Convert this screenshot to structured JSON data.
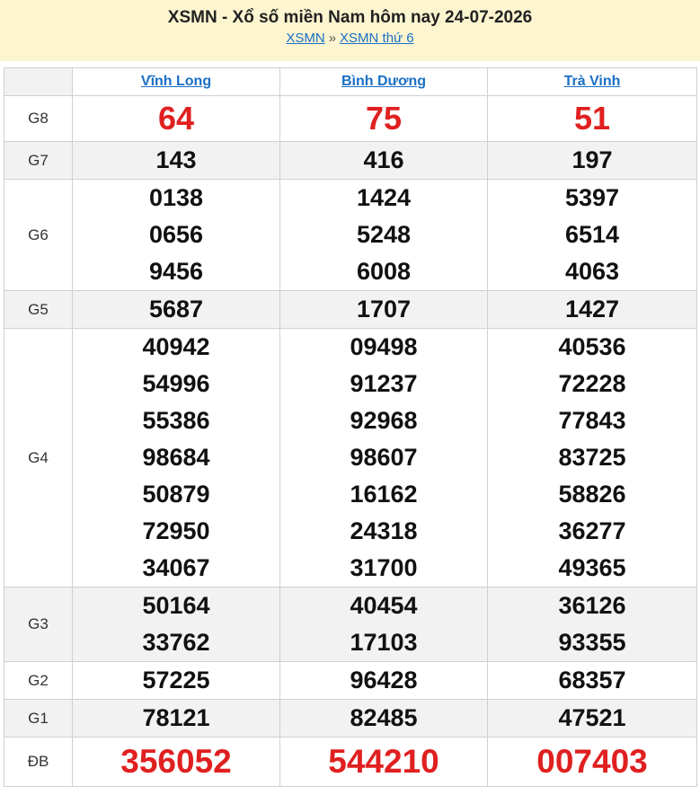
{
  "header": {
    "title": "XSMN - Xổ số miền Nam hôm nay 24-07-2026",
    "crumb1": "XSMN",
    "separator": "»",
    "crumb2": "XSMN thứ 6"
  },
  "provinces": [
    "Vĩnh Long",
    "Bình Dương",
    "Trà Vinh"
  ],
  "prizes": {
    "g8": {
      "label": "G8",
      "values": [
        "64",
        "75",
        "51"
      ]
    },
    "g7": {
      "label": "G7",
      "values": [
        "143",
        "416",
        "197"
      ]
    },
    "g6": {
      "label": "G6",
      "values": [
        [
          "0138",
          "0656",
          "9456"
        ],
        [
          "1424",
          "5248",
          "6008"
        ],
        [
          "5397",
          "6514",
          "4063"
        ]
      ]
    },
    "g5": {
      "label": "G5",
      "values": [
        "5687",
        "1707",
        "1427"
      ]
    },
    "g4": {
      "label": "G4",
      "values": [
        [
          "40942",
          "54996",
          "55386",
          "98684",
          "50879",
          "72950",
          "34067"
        ],
        [
          "09498",
          "91237",
          "92968",
          "98607",
          "16162",
          "24318",
          "31700"
        ],
        [
          "40536",
          "72228",
          "77843",
          "83725",
          "58826",
          "36277",
          "49365"
        ]
      ]
    },
    "g3": {
      "label": "G3",
      "values": [
        [
          "50164",
          "33762"
        ],
        [
          "40454",
          "17103"
        ],
        [
          "36126",
          "93355"
        ]
      ]
    },
    "g2": {
      "label": "G2",
      "values": [
        "57225",
        "96428",
        "68357"
      ]
    },
    "g1": {
      "label": "G1",
      "values": [
        "78121",
        "82485",
        "47521"
      ]
    },
    "db": {
      "label": "ĐB",
      "values": [
        "356052",
        "544210",
        "007403"
      ]
    }
  },
  "colors": {
    "header_bg": "#fdf5d0",
    "link": "#1a6fc4",
    "highlight_red": "#e02020",
    "alt_row": "#f2f2f2"
  }
}
